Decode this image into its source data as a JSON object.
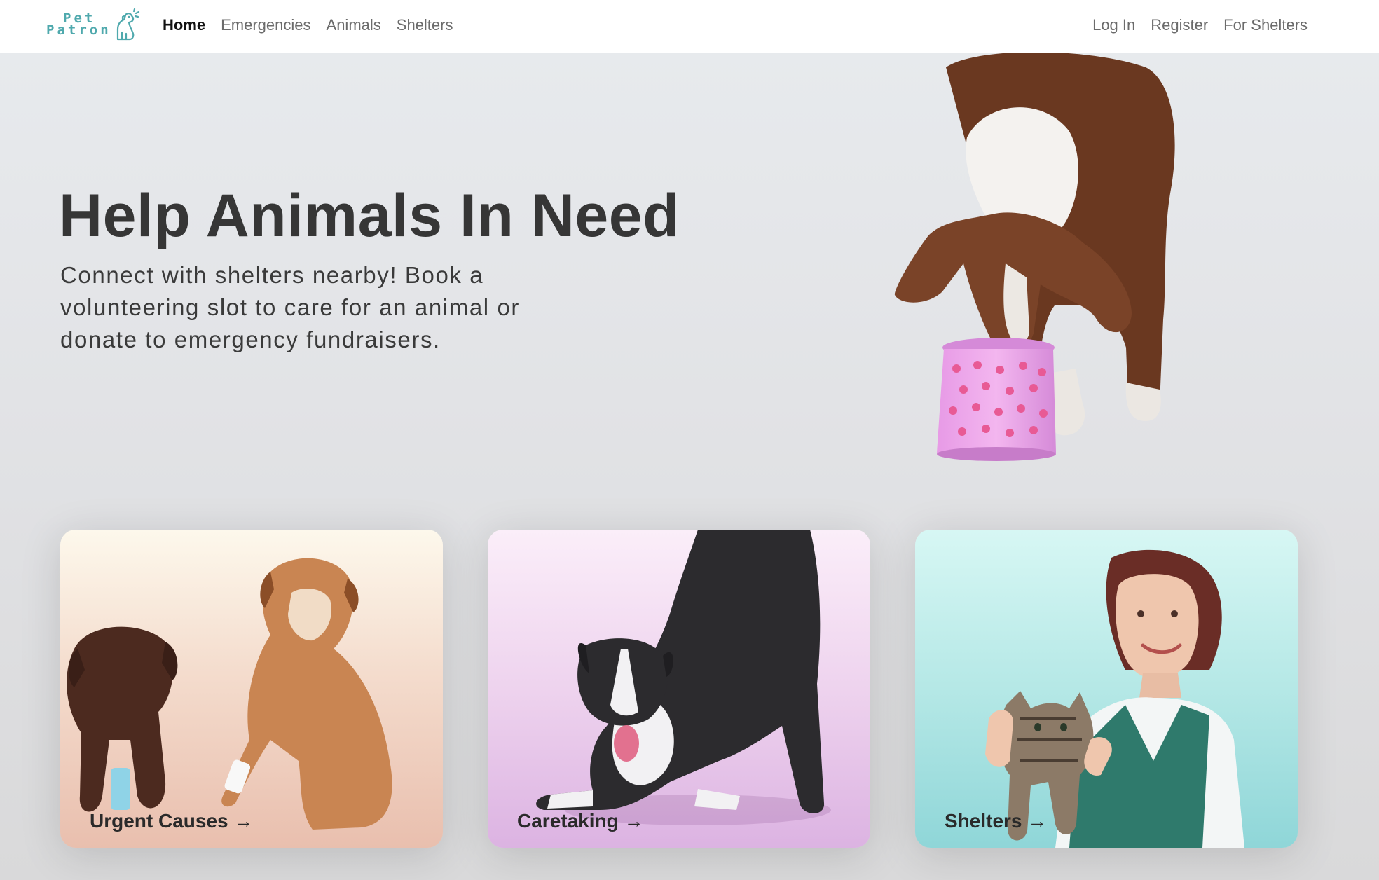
{
  "brand": {
    "line1": "Pet",
    "line2": "Patron",
    "color": "#4fa9ad"
  },
  "nav": {
    "left": [
      {
        "label": "Home",
        "active": true
      },
      {
        "label": "Emergencies",
        "active": false
      },
      {
        "label": "Animals",
        "active": false
      },
      {
        "label": "Shelters",
        "active": false
      }
    ],
    "right": [
      {
        "label": "Log In"
      },
      {
        "label": "Register"
      },
      {
        "label": "For Shelters"
      }
    ]
  },
  "hero": {
    "title": "Help Animals In Need",
    "subtitle": "Connect with shelters nearby! Book a volunteering slot to care for an animal or donate to emergency fundraisers."
  },
  "cards": [
    {
      "label": "Urgent Causes →",
      "image": "injured-puppy-and-dog"
    },
    {
      "label": "Caretaking →",
      "image": "playful-border-collie"
    },
    {
      "label": "Shelters →",
      "image": "volunteer-holding-kitten"
    }
  ]
}
